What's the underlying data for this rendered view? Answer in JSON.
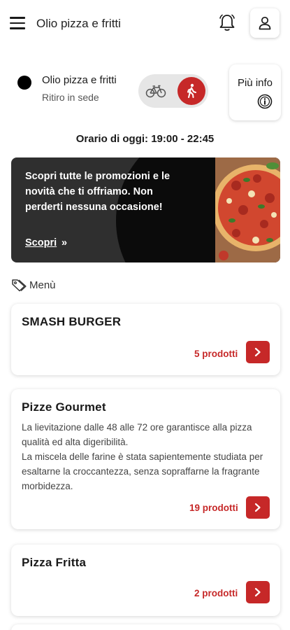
{
  "header": {
    "title": "Olio pizza e fritti"
  },
  "store": {
    "name": "Olio pizza e fritti",
    "mode": "Ritiro in sede",
    "more_info": "Più info"
  },
  "hours": "Orario di oggi: 19:00 - 22:45",
  "promo": {
    "text": "Scopri tutte le promozioni e le novità che ti offriamo. Non perderti nessuna occasione!",
    "cta": "Scopri",
    "cta_arrows": "»"
  },
  "menu": {
    "heading": "Menù",
    "categories": [
      {
        "title": "SMASH BURGER",
        "description": "",
        "count": "5 prodotti"
      },
      {
        "title": "Pizze Gourmet",
        "description": "La lievitazione dalle 48 alle 72 ore garantisce alla pizza qualità ed alta digeribilità.\nLa miscela delle farine è stata sapientemente studiata per esaltarne la croccantezza, senza sopraffarne la fragrante morbidezza.",
        "count": "19 prodotti"
      },
      {
        "title": "Pizza Fritta",
        "description": "",
        "count": "2 prodotti"
      }
    ]
  },
  "colors": {
    "accent": "#c62828",
    "promo_bg": "#0b0b0b",
    "text": "#1a1a1a"
  },
  "icons": {
    "menu": "hamburger-icon",
    "notifications": "bell-icon",
    "account": "user-icon",
    "bike": "bicycle-icon",
    "pickup": "walking-icon",
    "info": "info-icon",
    "tag": "tag-icon",
    "next": "chevron-right-icon"
  }
}
